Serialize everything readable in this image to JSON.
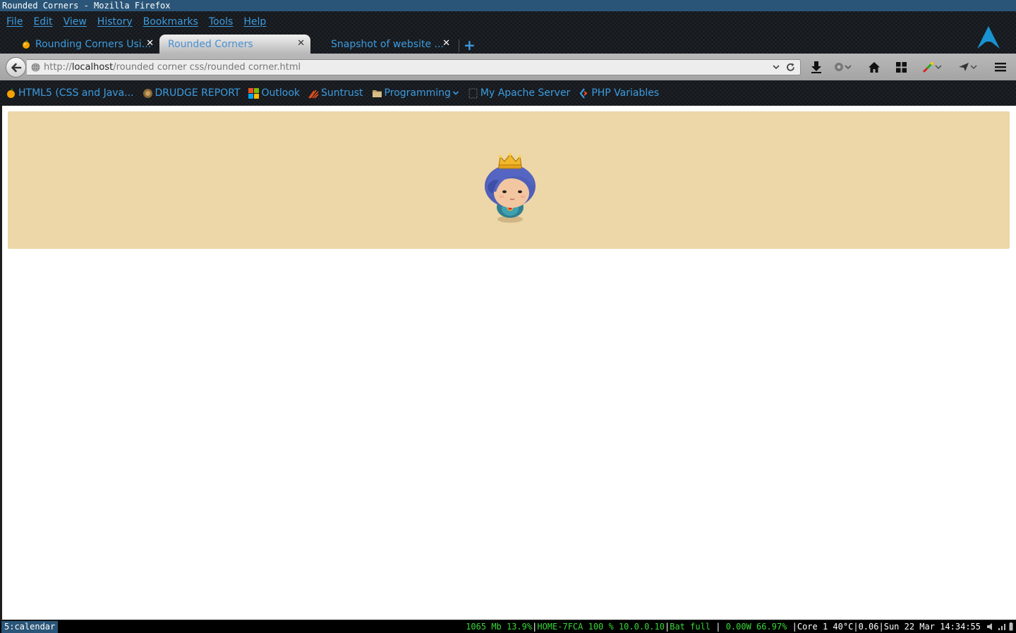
{
  "window": {
    "title": "Rounded Corners - Mozilla Firefox"
  },
  "menu": [
    "File",
    "Edit",
    "View",
    "History",
    "Bookmarks",
    "Tools",
    "Help"
  ],
  "tabs": [
    {
      "title": "Rounding Corners Usi...",
      "icon": "fruit-icon",
      "active": false
    },
    {
      "title": "Rounded Corners",
      "icon": "",
      "active": true
    },
    {
      "title": "Snapshot of website ...",
      "icon": "",
      "active": false
    }
  ],
  "tab_close_glyph": "✕",
  "new_tab_glyph": "+",
  "navbar": {
    "url_prefix": "http://",
    "url_host": "localhost",
    "url_path": "/rounded corner css/rounded corner.html"
  },
  "bookmarks": [
    {
      "label": "HTML5 (CSS and Java...",
      "icon": "fruit-icon"
    },
    {
      "label": "DRUDGE REPORT",
      "icon": "drudge-icon"
    },
    {
      "label": "Outlook",
      "icon": "windows-icon"
    },
    {
      "label": "Suntrust",
      "icon": "suntrust-icon"
    },
    {
      "label": "Programming",
      "icon": "folder-icon"
    },
    {
      "label": "My Apache Server",
      "icon": "page-icon"
    },
    {
      "label": "PHP Variables",
      "icon": "php-icon"
    }
  ],
  "page": {
    "box_color": "#edd6a7",
    "image": "princess-avatar"
  },
  "statusbar": {
    "workspace": "5:calendar",
    "memory": "1065 Mb 13.9%",
    "network": "HOME-7FCA 100 % 10.0.0.10",
    "battery": "Bat full",
    "power": "0.00W 66.97%",
    "cpu": "Core 1 40°C",
    "load": "0.06",
    "datetime": "Sun 22 Mar 14:34:55"
  },
  "colors": {
    "accent": "#3d9be0",
    "titlebar": "#2a5578",
    "status_green": "#38d838"
  }
}
